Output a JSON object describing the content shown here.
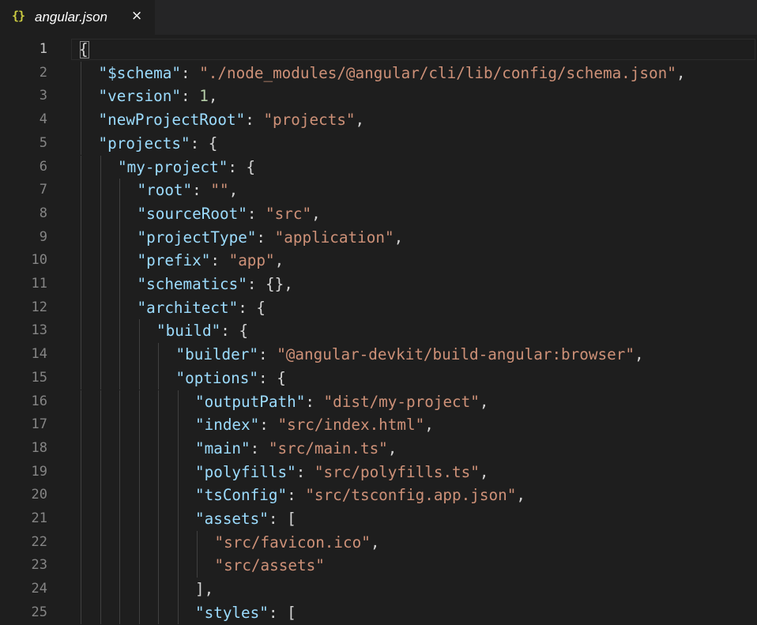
{
  "tab": {
    "icon": "{}",
    "title": "angular.json",
    "close": "×"
  },
  "editor": {
    "current_line": 1,
    "lines": [
      {
        "n": "1",
        "indent": 0,
        "tokens": [
          [
            "p",
            "{"
          ]
        ]
      },
      {
        "n": "2",
        "indent": 1,
        "tokens": [
          [
            "k",
            "\"$schema\""
          ],
          [
            "p",
            ": "
          ],
          [
            "s",
            "\"./node_modules/@angular/cli/lib/config/schema.json\""
          ],
          [
            "p",
            ","
          ]
        ]
      },
      {
        "n": "3",
        "indent": 1,
        "tokens": [
          [
            "k",
            "\"version\""
          ],
          [
            "p",
            ": "
          ],
          [
            "n",
            "1"
          ],
          [
            "p",
            ","
          ]
        ]
      },
      {
        "n": "4",
        "indent": 1,
        "tokens": [
          [
            "k",
            "\"newProjectRoot\""
          ],
          [
            "p",
            ": "
          ],
          [
            "s",
            "\"projects\""
          ],
          [
            "p",
            ","
          ]
        ]
      },
      {
        "n": "5",
        "indent": 1,
        "tokens": [
          [
            "k",
            "\"projects\""
          ],
          [
            "p",
            ": {"
          ]
        ]
      },
      {
        "n": "6",
        "indent": 2,
        "tokens": [
          [
            "k",
            "\"my-project\""
          ],
          [
            "p",
            ": {"
          ]
        ]
      },
      {
        "n": "7",
        "indent": 3,
        "tokens": [
          [
            "k",
            "\"root\""
          ],
          [
            "p",
            ": "
          ],
          [
            "s",
            "\"\""
          ],
          [
            "p",
            ","
          ]
        ]
      },
      {
        "n": "8",
        "indent": 3,
        "tokens": [
          [
            "k",
            "\"sourceRoot\""
          ],
          [
            "p",
            ": "
          ],
          [
            "s",
            "\"src\""
          ],
          [
            "p",
            ","
          ]
        ]
      },
      {
        "n": "9",
        "indent": 3,
        "tokens": [
          [
            "k",
            "\"projectType\""
          ],
          [
            "p",
            ": "
          ],
          [
            "s",
            "\"application\""
          ],
          [
            "p",
            ","
          ]
        ]
      },
      {
        "n": "10",
        "indent": 3,
        "tokens": [
          [
            "k",
            "\"prefix\""
          ],
          [
            "p",
            ": "
          ],
          [
            "s",
            "\"app\""
          ],
          [
            "p",
            ","
          ]
        ]
      },
      {
        "n": "11",
        "indent": 3,
        "tokens": [
          [
            "k",
            "\"schematics\""
          ],
          [
            "p",
            ": {},"
          ]
        ]
      },
      {
        "n": "12",
        "indent": 3,
        "tokens": [
          [
            "k",
            "\"architect\""
          ],
          [
            "p",
            ": {"
          ]
        ]
      },
      {
        "n": "13",
        "indent": 4,
        "tokens": [
          [
            "k",
            "\"build\""
          ],
          [
            "p",
            ": {"
          ]
        ]
      },
      {
        "n": "14",
        "indent": 5,
        "tokens": [
          [
            "k",
            "\"builder\""
          ],
          [
            "p",
            ": "
          ],
          [
            "s",
            "\"@angular-devkit/build-angular:browser\""
          ],
          [
            "p",
            ","
          ]
        ]
      },
      {
        "n": "15",
        "indent": 5,
        "tokens": [
          [
            "k",
            "\"options\""
          ],
          [
            "p",
            ": {"
          ]
        ]
      },
      {
        "n": "16",
        "indent": 6,
        "tokens": [
          [
            "k",
            "\"outputPath\""
          ],
          [
            "p",
            ": "
          ],
          [
            "s",
            "\"dist/my-project\""
          ],
          [
            "p",
            ","
          ]
        ]
      },
      {
        "n": "17",
        "indent": 6,
        "tokens": [
          [
            "k",
            "\"index\""
          ],
          [
            "p",
            ": "
          ],
          [
            "s",
            "\"src/index.html\""
          ],
          [
            "p",
            ","
          ]
        ]
      },
      {
        "n": "18",
        "indent": 6,
        "tokens": [
          [
            "k",
            "\"main\""
          ],
          [
            "p",
            ": "
          ],
          [
            "s",
            "\"src/main.ts\""
          ],
          [
            "p",
            ","
          ]
        ]
      },
      {
        "n": "19",
        "indent": 6,
        "tokens": [
          [
            "k",
            "\"polyfills\""
          ],
          [
            "p",
            ": "
          ],
          [
            "s",
            "\"src/polyfills.ts\""
          ],
          [
            "p",
            ","
          ]
        ]
      },
      {
        "n": "20",
        "indent": 6,
        "tokens": [
          [
            "k",
            "\"tsConfig\""
          ],
          [
            "p",
            ": "
          ],
          [
            "s",
            "\"src/tsconfig.app.json\""
          ],
          [
            "p",
            ","
          ]
        ]
      },
      {
        "n": "21",
        "indent": 6,
        "tokens": [
          [
            "k",
            "\"assets\""
          ],
          [
            "p",
            ": ["
          ]
        ]
      },
      {
        "n": "22",
        "indent": 7,
        "tokens": [
          [
            "s",
            "\"src/favicon.ico\""
          ],
          [
            "p",
            ","
          ]
        ]
      },
      {
        "n": "23",
        "indent": 7,
        "tokens": [
          [
            "s",
            "\"src/assets\""
          ]
        ]
      },
      {
        "n": "24",
        "indent": 6,
        "tokens": [
          [
            "p",
            "],"
          ]
        ]
      },
      {
        "n": "25",
        "indent": 6,
        "tokens": [
          [
            "k",
            "\"styles\""
          ],
          [
            "p",
            ": ["
          ]
        ]
      }
    ]
  },
  "colors": {
    "background": "#1e1e1e",
    "key": "#9cdcfe",
    "string": "#ce9178",
    "number": "#b5cea8",
    "punctuation": "#d4d4d4",
    "json_icon": "#cbcb41"
  }
}
